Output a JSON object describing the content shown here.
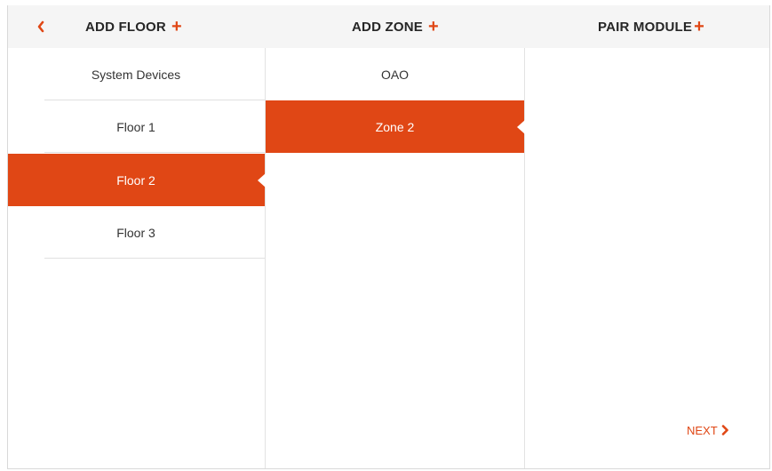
{
  "header": {
    "back_icon": "chevron-left-icon",
    "add_floor_label": "ADD FLOOR",
    "add_zone_label": "ADD ZONE",
    "pair_module_label": "PAIR MODULE",
    "plus_symbol": "+"
  },
  "floors": {
    "items": [
      {
        "label": "System Devices",
        "selected": false
      },
      {
        "label": "Floor 1",
        "selected": false
      },
      {
        "label": "Floor 2",
        "selected": true
      },
      {
        "label": "Floor 3",
        "selected": false
      }
    ]
  },
  "zones": {
    "items": [
      {
        "label": "OAO",
        "selected": false
      },
      {
        "label": "Zone 2",
        "selected": true
      }
    ]
  },
  "footer": {
    "next_label": "NEXT",
    "next_icon": "chevron-right-icon"
  },
  "colors": {
    "accent": "#e04715",
    "header_bg": "#f5f5f5",
    "text": "#333333"
  }
}
